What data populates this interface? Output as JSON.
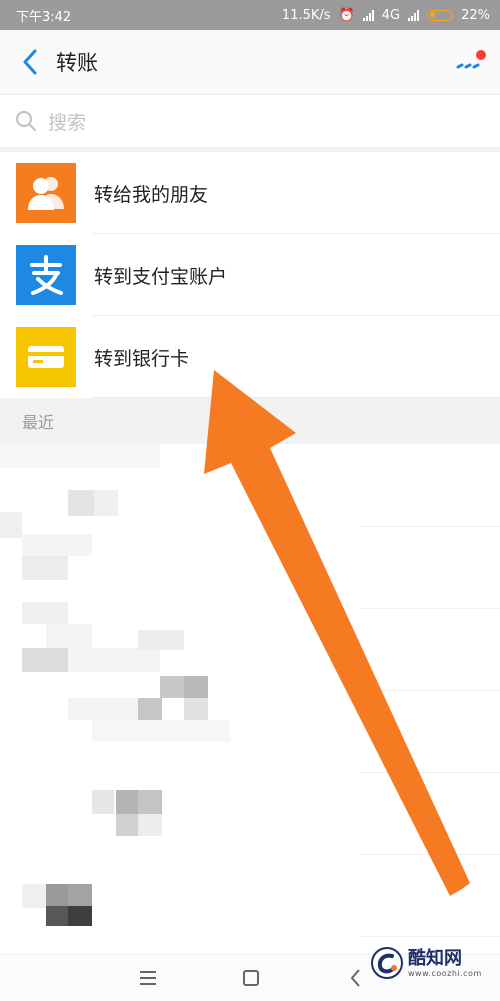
{
  "status_bar": {
    "time": "下午3:42",
    "speed": "11.5K/s",
    "network": "4G",
    "battery": "22%"
  },
  "header": {
    "back_icon": "chevron-left-icon",
    "title": "转账",
    "more_icon": "more-dots-icon"
  },
  "search": {
    "placeholder": "搜索",
    "icon": "search-icon"
  },
  "options": [
    {
      "label": "转给我的朋友",
      "icon": "friends-icon",
      "color": "#f57c1f"
    },
    {
      "label": "转到支付宝账户",
      "icon": "alipay-icon",
      "color": "#1e88e5"
    },
    {
      "label": "转到银行卡",
      "icon": "bank-card-icon",
      "color": "#f5c500"
    }
  ],
  "recent": {
    "label": "最近"
  },
  "navbar": {
    "menu_icon": "menu-icon",
    "home_icon": "home-square-icon",
    "back_icon": "back-triangle-icon"
  },
  "watermark": {
    "name": "酷知网",
    "site": "www.coozhi.com"
  },
  "colors": {
    "accent_blue": "#1e88e5",
    "annotation_arrow": "#f57a22",
    "alert_dot": "#ff3b30"
  }
}
